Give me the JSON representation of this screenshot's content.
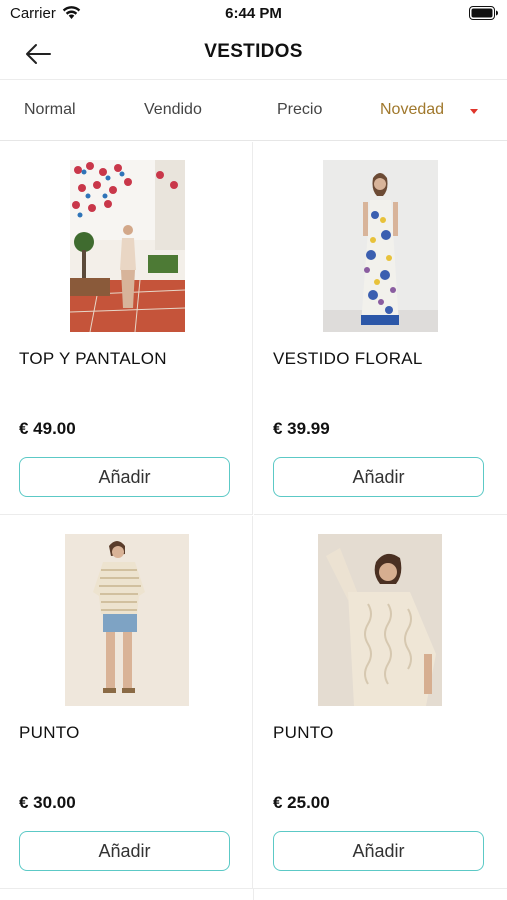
{
  "status_bar": {
    "carrier": "Carrier",
    "time": "6:44 PM",
    "wifi_icon": "wifi-icon",
    "battery_icon": "battery-icon"
  },
  "nav": {
    "title": "VESTIDOS",
    "back_icon": "back-arrow-icon"
  },
  "sort": {
    "tabs": [
      {
        "label": "Normal",
        "active": false
      },
      {
        "label": "Vendido",
        "active": false
      },
      {
        "label": "Precio",
        "active": false
      },
      {
        "label": "Novedad",
        "active": true
      }
    ],
    "active_color": "#a0782c",
    "arrow_color": "#e0352b",
    "arrow_icon": "caret-down-icon"
  },
  "products": [
    {
      "name": "TOP Y PANTALON",
      "price": "€ 49.00",
      "add_label": "Añadir"
    },
    {
      "name": "VESTIDO FLORAL",
      "price": "€ 39.99",
      "add_label": "Añadir"
    },
    {
      "name": "PUNTO",
      "price": "€ 30.00",
      "add_label": "Añadir"
    },
    {
      "name": "PUNTO",
      "price": "€ 25.00",
      "add_label": "Añadir"
    }
  ],
  "colors": {
    "button_border": "#5cc9c6",
    "divider": "#ececec"
  }
}
